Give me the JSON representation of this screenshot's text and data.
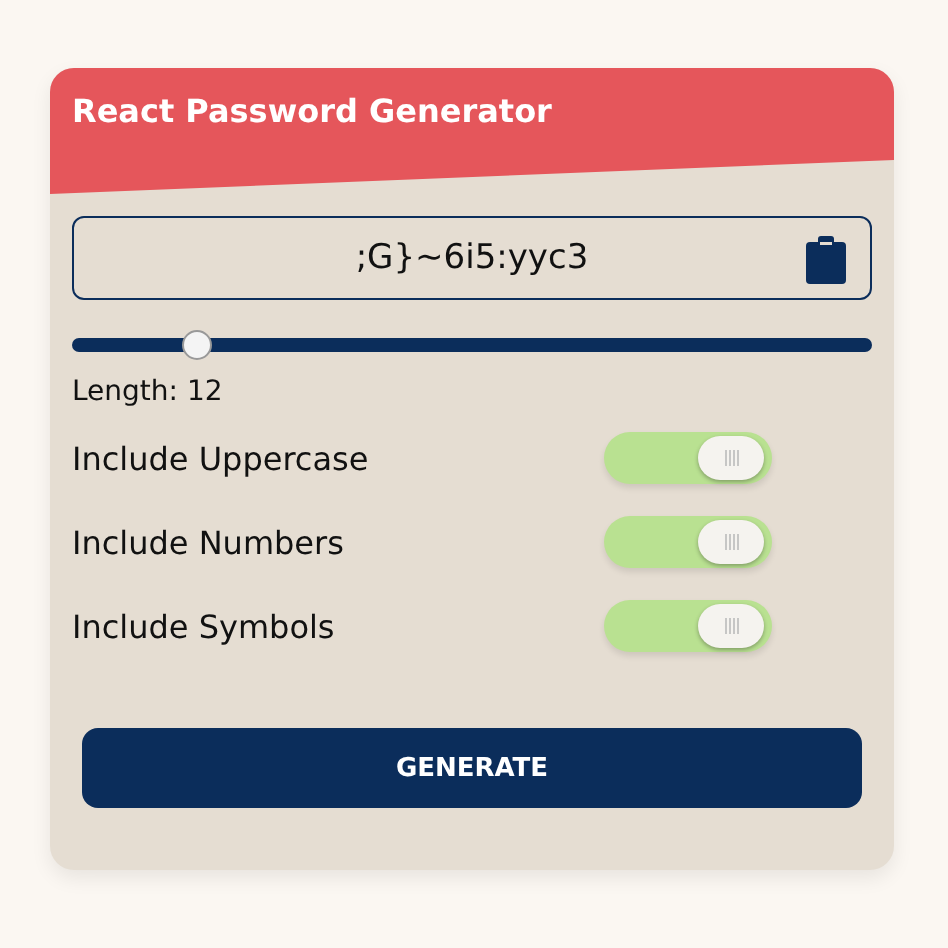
{
  "header": {
    "title": "React Password Generator"
  },
  "password": {
    "value": ";G}~6i5:yyc3"
  },
  "length_slider": {
    "level": 0.155
  },
  "length_label": "Length: 12",
  "options": [
    {
      "label": "Include Uppercase",
      "on": true
    },
    {
      "label": "Include Numbers",
      "on": true
    },
    {
      "label": "Include Symbols",
      "on": true
    }
  ],
  "generate_button": "GENERATE"
}
